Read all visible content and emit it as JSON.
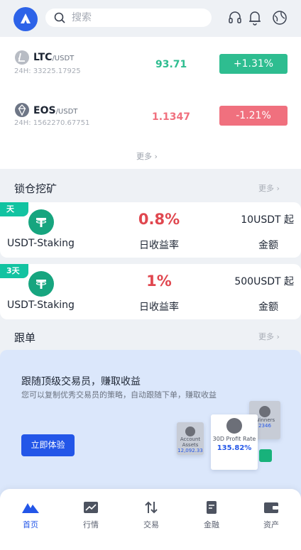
{
  "header": {
    "search_placeholder": "搜索"
  },
  "market": {
    "rows": [
      {
        "base": "LTC",
        "quote": "/USDT",
        "volume": "24H: 33225.17925",
        "price": "93.71",
        "change": "+1.31%"
      },
      {
        "base": "EOS",
        "quote": "/USDT",
        "volume": "24H: 1562270.67751",
        "price": "1.1347",
        "change": "-1.21%"
      }
    ],
    "more_label": "更多",
    "up_color": "#2ebd90",
    "down_color": "#f0707e"
  },
  "lock_mining": {
    "title": "锁仓挖矿",
    "more_label": "更多",
    "products": [
      {
        "tag": "天",
        "name": "USDT-Staking",
        "rate": "0.8%",
        "rate_label": "日收益率",
        "min": "10USDT 起",
        "min_label": "金额"
      },
      {
        "tag": "3天",
        "name": "USDT-Staking",
        "rate": "1%",
        "rate_label": "日收益率",
        "min": "500USDT 起",
        "min_label": "金额"
      }
    ]
  },
  "copy_trading": {
    "title": "跟单",
    "more_label": "更多",
    "banner_title": "跟随顶级交易员，赚取收益",
    "banner_desc": "您可以复制优秀交易员的策略，自动跟随下单，赚取收益",
    "cta": "立即体验",
    "card_main_label": "30D Profit Rate",
    "card_main_value": "135.82%",
    "card_left_name": "Account Assets",
    "card_left_value": "12,092.33",
    "card_right_name": "Winners",
    "card_right_value": "2346"
  },
  "nav": {
    "items": [
      {
        "label": "首页",
        "icon": "home-mountain-icon",
        "active": true
      },
      {
        "label": "行情",
        "icon": "chart-icon",
        "active": false
      },
      {
        "label": "交易",
        "icon": "trade-arrows-icon",
        "active": false
      },
      {
        "label": "金融",
        "icon": "finance-doc-icon",
        "active": false
      },
      {
        "label": "资产",
        "icon": "wallet-icon",
        "active": false
      }
    ],
    "active_color": "#2356e8"
  }
}
